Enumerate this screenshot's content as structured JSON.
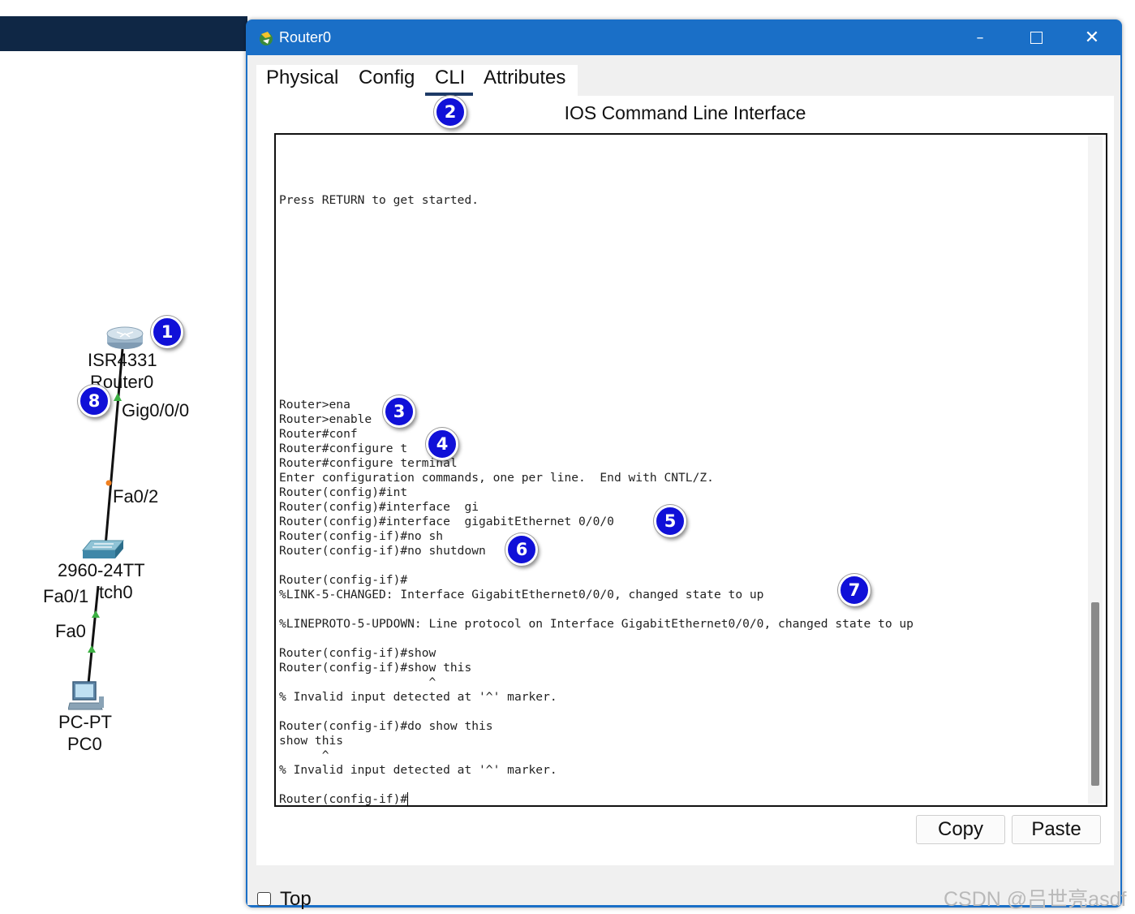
{
  "topology": {
    "router": {
      "model": "ISR4331",
      "name": "Router0",
      "port": "Gig0/0/0"
    },
    "switch": {
      "model": "2960-24TT",
      "name_visible": "tch0",
      "port_up": "Fa0/2",
      "port_down": "Fa0/1"
    },
    "pc": {
      "model": "PC-PT",
      "name": "PC0",
      "port": "Fa0"
    },
    "icons": {
      "router": "router-icon",
      "switch": "switch-icon",
      "pc": "pc-icon"
    }
  },
  "badges": {
    "b1": "1",
    "b2": "2",
    "b3": "3",
    "b4": "4",
    "b5": "5",
    "b6": "6",
    "b7": "7",
    "b8": "8"
  },
  "window": {
    "title": "Router0",
    "icon": "packet-tracer-icon",
    "controls": {
      "minimize": "–",
      "close": "✕"
    },
    "tabs": [
      "Physical",
      "Config",
      "CLI",
      "Attributes"
    ],
    "active_tab": "CLI",
    "heading": "IOS Command Line Interface",
    "terminal_lines": [
      "Press RETURN to get started.",
      "",
      "",
      "",
      "",
      "",
      "",
      "",
      "",
      "",
      "",
      "",
      "",
      "",
      "Router>ena",
      "Router>enable",
      "Router#conf",
      "Router#configure t",
      "Router#configure terminal",
      "Enter configuration commands, one per line.  End with CNTL/Z.",
      "Router(config)#int",
      "Router(config)#interface  gi",
      "Router(config)#interface  gigabitEthernet 0/0/0",
      "Router(config-if)#no sh",
      "Router(config-if)#no shutdown",
      "",
      "Router(config-if)#",
      "%LINK-5-CHANGED: Interface GigabitEthernet0/0/0, changed state to up",
      "",
      "%LINEPROTO-5-UPDOWN: Line protocol on Interface GigabitEthernet0/0/0, changed state to up",
      "",
      "Router(config-if)#show",
      "Router(config-if)#show this",
      "                     ^",
      "% Invalid input detected at '^' marker.",
      "",
      "Router(config-if)#do show this",
      "show this",
      "      ^",
      "% Invalid input detected at '^' marker.",
      "",
      "Router(config-if)#"
    ],
    "buttons": {
      "copy": "Copy",
      "paste": "Paste"
    },
    "top_checkbox": {
      "label": "Top",
      "checked": false
    }
  },
  "watermark": "CSDN @吕世亮asdf",
  "colors": {
    "titlebar": "#1a6fc7",
    "badge": "#1010d8",
    "topbar": "#0f2745",
    "link_up": "#3cb043",
    "link_amber": "#f08020"
  }
}
